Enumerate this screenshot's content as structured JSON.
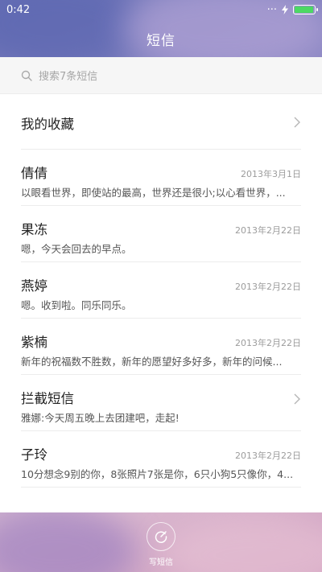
{
  "status_bar": {
    "time": "0:42",
    "battery_level": 0.95
  },
  "header": {
    "title": "短信"
  },
  "search": {
    "placeholder": "搜索7条短信"
  },
  "favorites": {
    "label": "我的收藏"
  },
  "conversations": [
    {
      "name": "倩倩",
      "date": "2013年3月1日",
      "preview": "以眼看世界，即使站的最高，世界还是很小;以心看世界，..."
    },
    {
      "name": "果冻",
      "date": "2013年2月22日",
      "preview": "嗯，今天会回去的早点。"
    },
    {
      "name": "燕婷",
      "date": "2013年2月22日",
      "preview": "嗯。收到啦。同乐同乐。"
    },
    {
      "name": "紫楠",
      "date": "2013年2月22日",
      "preview": "新年的祝福数不胜数，新年的愿望好多好多，新年的问候..."
    }
  ],
  "blocked": {
    "name": "拦截短信",
    "preview": "雅娜:今天周五晚上去团建吧，走起!"
  },
  "last_conversation": {
    "name": "子玲",
    "date": "2013年2月22日",
    "preview": "10分想念9别的你，8张照片7张是你，6只小狗5只像你，4..."
  },
  "compose": {
    "label": "写短信"
  },
  "colors": {
    "accent": "#4cd964",
    "text_primary": "#222222",
    "text_secondary": "#9c9c9c"
  }
}
